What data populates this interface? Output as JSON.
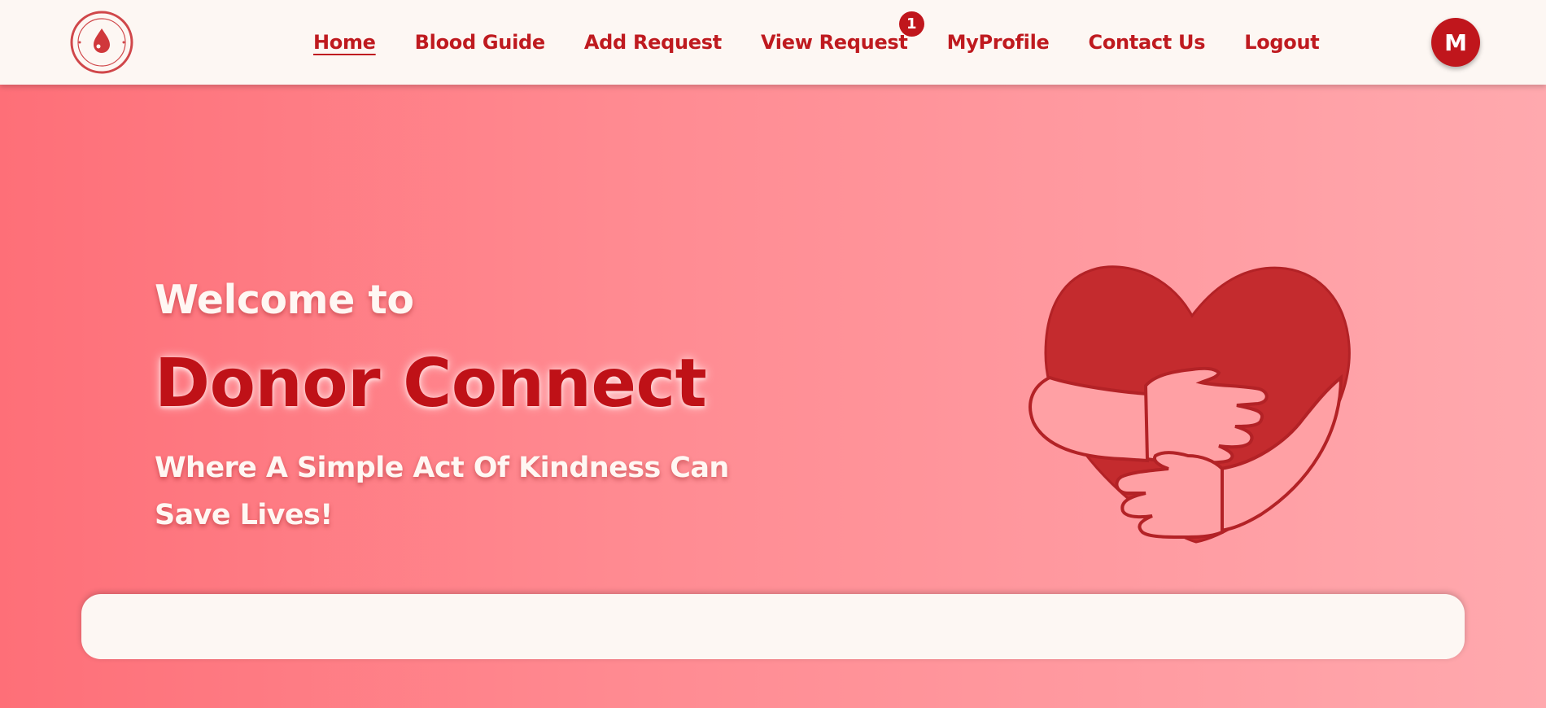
{
  "logo": {
    "icon": "blood-drop-logo-icon",
    "ring_text_top": "DONATE BLOOD",
    "ring_text_bottom": "SAVE LIFE"
  },
  "nav": {
    "items": [
      {
        "label": "Home",
        "active": true
      },
      {
        "label": "Blood Guide"
      },
      {
        "label": "Add Request"
      },
      {
        "label": "View Request",
        "badge": "1"
      },
      {
        "label": "MyProfile"
      },
      {
        "label": "Contact Us"
      },
      {
        "label": "Logout"
      }
    ]
  },
  "avatar": {
    "initial": "M"
  },
  "hero": {
    "welcome": "Welcome to",
    "brand": "Donor Connect",
    "tagline": "Where A Simple Act Of Kindness Can Save Lives!",
    "illustration": "heart-hug-icon"
  },
  "colors": {
    "primary": "#bf1a1f",
    "badge": "#c0161c",
    "hero_gradient_start": "#fe6f78",
    "hero_gradient_end": "#ffa9ae",
    "heart": "#c42b2e",
    "navbar_bg": "#fdf7f3"
  }
}
